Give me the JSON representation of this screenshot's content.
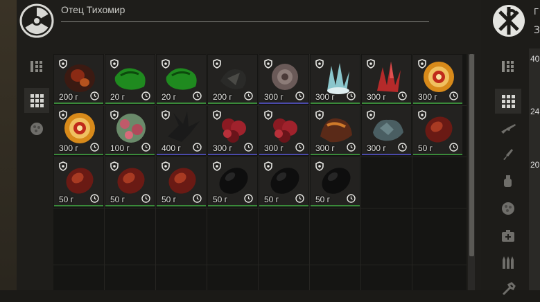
{
  "trader": {
    "name": "Отец Тихомир",
    "logo_icon": "radiation-icon"
  },
  "right_panel": {
    "logo_icon": "chi-rho-icon",
    "values": [
      "40",
      "24",
      "20"
    ],
    "letters": [
      "Г",
      "З"
    ]
  },
  "tabs": [
    "sort-list-icon",
    "grid-view-icon",
    "artifact-category-icon"
  ],
  "right_tabs": [
    "sort-list-icon",
    "grid-view-icon",
    "rifle-icon",
    "knife-icon",
    "grenade-icon",
    "artifact-icon",
    "medkit-icon",
    "ammo-icon",
    "tools-icon"
  ],
  "items": [
    {
      "price": "200 г",
      "kind": "dark-red",
      "border": "#3a8a3a"
    },
    {
      "price": "20 г",
      "kind": "green",
      "border": "#3a8a3a"
    },
    {
      "price": "20 г",
      "kind": "green",
      "border": "#3a8a3a"
    },
    {
      "price": "200 г",
      "kind": "dark",
      "border": "#3a8a3a"
    },
    {
      "price": "300 г",
      "kind": "grey-rose",
      "border": "#4a4aaa"
    },
    {
      "price": "300 г",
      "kind": "crystal-cyan",
      "border": "#3a8a3a"
    },
    {
      "price": "300 г",
      "kind": "crystal-red",
      "border": "#3a8a3a"
    },
    {
      "price": "300 г",
      "kind": "swirl",
      "border": "#3a8a3a"
    },
    {
      "price": "300 г",
      "kind": "swirl",
      "border": "#3a8a3a"
    },
    {
      "price": "100 г",
      "kind": "pink-green",
      "border": "#3a8a3a"
    },
    {
      "price": "400 г",
      "kind": "dark-spike",
      "border": "#4a4aaa"
    },
    {
      "price": "300 г",
      "kind": "red-cluster",
      "border": "#4a4aaa"
    },
    {
      "price": "300 г",
      "kind": "red-cluster",
      "border": "#4a4aaa"
    },
    {
      "price": "300 г",
      "kind": "brown-rock",
      "border": "#3a8a3a"
    },
    {
      "price": "300 г",
      "kind": "teal-rock",
      "border": "#4a4aaa"
    },
    {
      "price": "50 г",
      "kind": "red-egg",
      "border": "#3a8a3a"
    },
    {
      "price": "50 г",
      "kind": "red-egg",
      "border": "#3a8a3a"
    },
    {
      "price": "50 г",
      "kind": "red-egg",
      "border": "#3a8a3a"
    },
    {
      "price": "50 г",
      "kind": "red-egg",
      "border": "#3a8a3a"
    },
    {
      "price": "50 г",
      "kind": "black-egg",
      "border": "#3a8a3a"
    },
    {
      "price": "50 г",
      "kind": "black-egg",
      "border": "#3a8a3a"
    },
    {
      "price": "50 г",
      "kind": "black-egg",
      "border": "#3a8a3a"
    }
  ]
}
